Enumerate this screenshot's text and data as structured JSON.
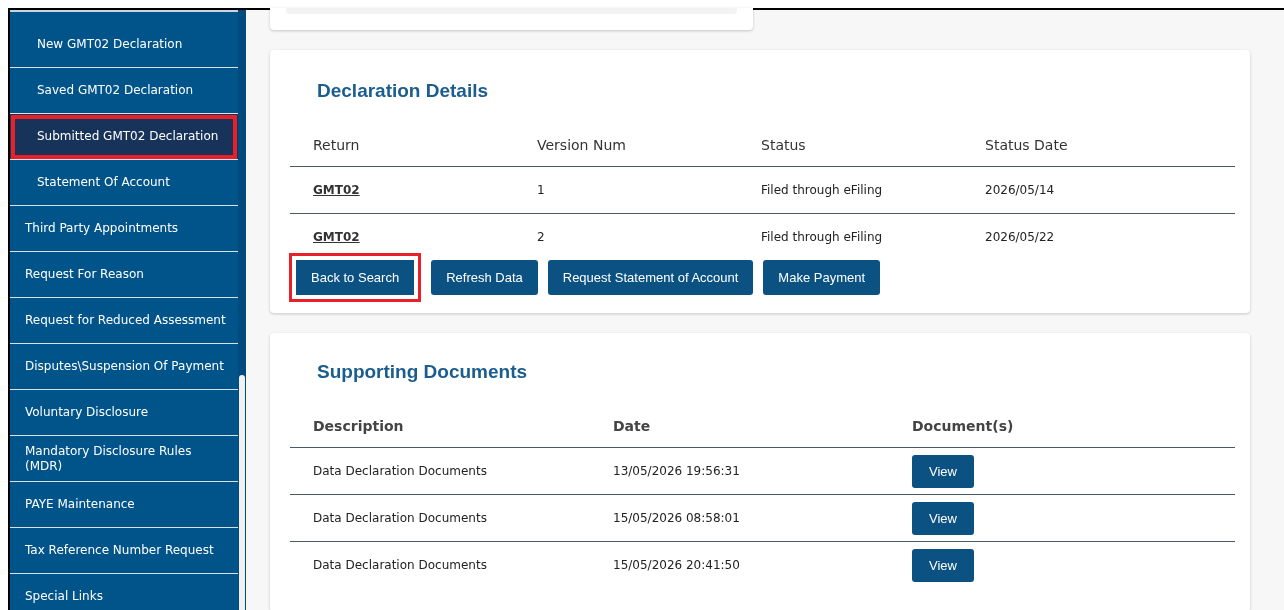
{
  "sidebar": {
    "items": [
      {
        "label": "New GMT02 Declaration",
        "kind": "subitem",
        "selected": false,
        "highlighted": false
      },
      {
        "label": "Saved GMT02 Declaration",
        "kind": "subitem",
        "selected": false,
        "highlighted": false
      },
      {
        "label": "Submitted GMT02 Declaration",
        "kind": "subitem",
        "selected": true,
        "highlighted": true
      },
      {
        "label": "Statement Of Account",
        "kind": "subitem",
        "selected": false,
        "highlighted": false
      },
      {
        "label": "Third Party Appointments",
        "kind": "item",
        "selected": false,
        "highlighted": false
      },
      {
        "label": "Request For Reason",
        "kind": "item",
        "selected": false,
        "highlighted": false
      },
      {
        "label": "Request for Reduced Assessment",
        "kind": "item",
        "selected": false,
        "highlighted": false
      },
      {
        "label": "Disputes\\Suspension Of Payment",
        "kind": "item",
        "selected": false,
        "highlighted": false
      },
      {
        "label": "Voluntary Disclosure",
        "kind": "item",
        "selected": false,
        "highlighted": false
      },
      {
        "label": "Mandatory Disclosure Rules (MDR)",
        "kind": "item",
        "selected": false,
        "highlighted": false
      },
      {
        "label": "PAYE Maintenance",
        "kind": "item",
        "selected": false,
        "highlighted": false
      },
      {
        "label": "Tax Reference Number Request",
        "kind": "item",
        "selected": false,
        "highlighted": false
      },
      {
        "label": "Special Links",
        "kind": "item",
        "selected": false,
        "highlighted": false
      }
    ]
  },
  "declaration_details": {
    "title": "Declaration Details",
    "columns": [
      "Return",
      "Version Num",
      "Status",
      "Status Date"
    ],
    "rows": [
      [
        "GMT02",
        "1",
        "Filed through eFiling",
        "2026/05/14"
      ],
      [
        "GMT02",
        "2",
        "Filed through eFiling",
        "2026/05/22"
      ]
    ],
    "buttons": [
      {
        "label": "Back to Search",
        "highlighted": true
      },
      {
        "label": "Refresh Data",
        "highlighted": false
      },
      {
        "label": "Request Statement of Account",
        "highlighted": false
      },
      {
        "label": "Make Payment",
        "highlighted": false
      }
    ]
  },
  "supporting_documents": {
    "title": "Supporting Documents",
    "columns": [
      "Description",
      "Date",
      "Document(s)"
    ],
    "rows": [
      {
        "description": "Data Declaration Documents",
        "date": "13/05/2026 19:56:31",
        "action": "View"
      },
      {
        "description": "Data Declaration Documents",
        "date": "15/05/2026 08:58:01",
        "action": "View"
      },
      {
        "description": "Data Declaration Documents",
        "date": "15/05/2026 20:41:50",
        "action": "View"
      }
    ]
  }
}
